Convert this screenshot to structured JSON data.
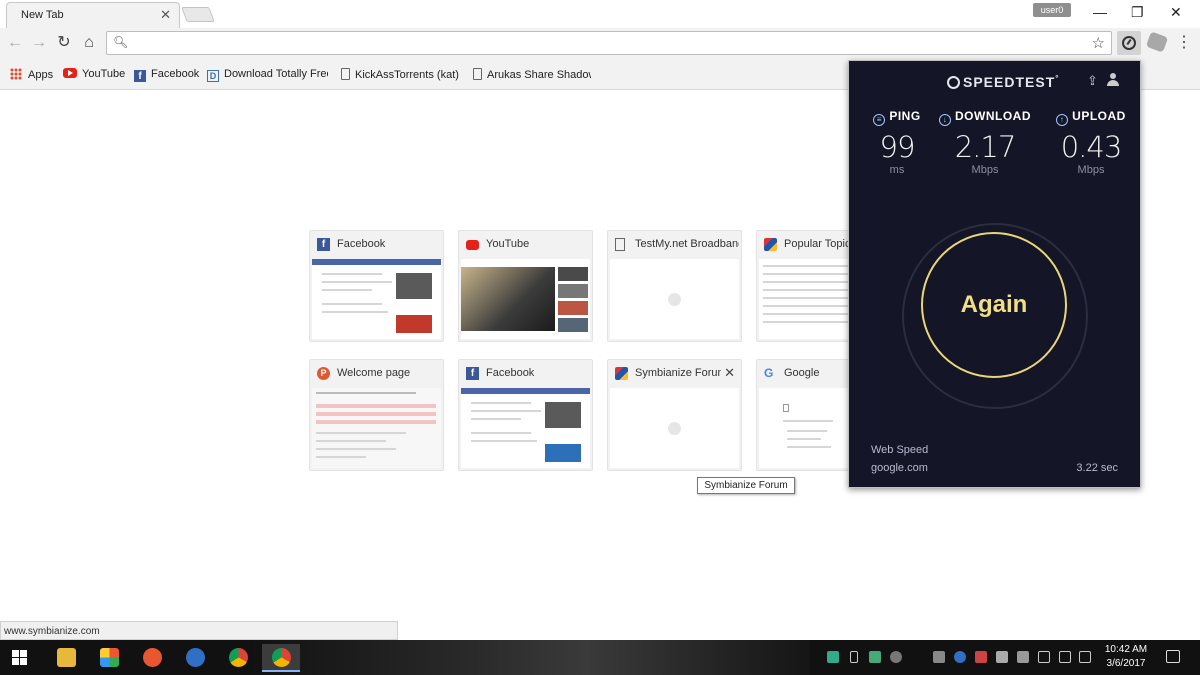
{
  "browser": {
    "tab_title": "New Tab",
    "tab_close": "✕",
    "user_name": "user0",
    "window_minimize": "—",
    "window_restore": "❐",
    "window_close": "✕",
    "omnibox_value": "",
    "back": "←",
    "forward": "→",
    "reload": "↻",
    "home": "⌂",
    "star": "☆",
    "menu": "⋮"
  },
  "bookmarks": [
    {
      "label": "Apps",
      "icon": "apps-grid-icon"
    },
    {
      "label": "YouTube",
      "icon": "youtube-icon"
    },
    {
      "label": "Facebook",
      "icon": "facebook-icon"
    },
    {
      "label": "Download Totally Free",
      "icon": "d-icon"
    },
    {
      "label": "KickAssTorrents (kat) F",
      "icon": "page-icon"
    },
    {
      "label": "Arukas Share Shadow",
      "icon": "page-icon"
    }
  ],
  "tiles": [
    {
      "title": "Facebook",
      "icon": "facebook-icon"
    },
    {
      "title": "YouTube",
      "icon": "youtube-icon"
    },
    {
      "title": "TestMy.net Broadband",
      "icon": "page-icon"
    },
    {
      "title": "Popular Topics",
      "icon": "symbianize-icon"
    },
    {
      "title": "Welcome page",
      "icon": "p-icon"
    },
    {
      "title": "Facebook",
      "icon": "facebook-icon"
    },
    {
      "title": "Symbianize Forum",
      "icon": "symbianize-icon",
      "close": "✕"
    },
    {
      "title": "Google",
      "icon": "google-icon"
    }
  ],
  "tooltip": "Symbianize Forum",
  "speedtest": {
    "logo": "SPEEDTEST",
    "ping": {
      "label": "PING",
      "value": "99",
      "unit": "ms"
    },
    "download": {
      "label": "DOWNLOAD",
      "value": "2.17",
      "unit": "Mbps"
    },
    "upload": {
      "label": "UPLOAD",
      "value": "0.43",
      "unit": "Mbps"
    },
    "again_label": "Again",
    "source_label": "Web Speed",
    "source": "google.com",
    "time": "3.22 sec",
    "colors": {
      "bg": "#141526",
      "accent": "#f1df86",
      "metric_icon": "#9ec7ff"
    }
  },
  "status_url": "www.symbianize.com",
  "taskbar": {
    "time": "10:42 AM",
    "date": "3/6/2017"
  }
}
